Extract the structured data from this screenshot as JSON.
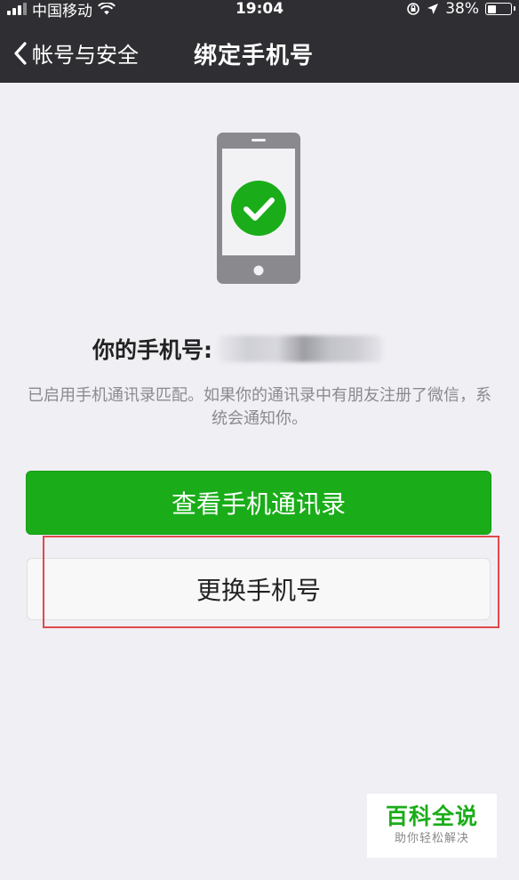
{
  "status_bar": {
    "carrier": "中国移动",
    "time": "19:04",
    "battery": "38%"
  },
  "nav": {
    "back_label": "帐号与安全",
    "title": "绑定手机号"
  },
  "main": {
    "phone_label": "你的手机号:",
    "hint": "已启用手机通讯录匹配。如果你的通讯录中有朋友注册了微信，系统会通知你。",
    "view_contacts_button": "查看手机通讯录",
    "change_phone_button": "更换手机号"
  },
  "watermark": {
    "title": "百科全说",
    "subtitle": "助你轻松解决"
  },
  "colors": {
    "header_bg": "#2f2f33",
    "page_bg": "#efeff4",
    "wechat_green": "#1aad19",
    "highlight_red": "#e04a4a"
  },
  "icons": [
    "signal-icon",
    "wifi-icon",
    "lock-rotation-icon",
    "location-icon",
    "battery-icon",
    "back-chevron-icon",
    "phone-illustration-icon",
    "check-icon"
  ]
}
